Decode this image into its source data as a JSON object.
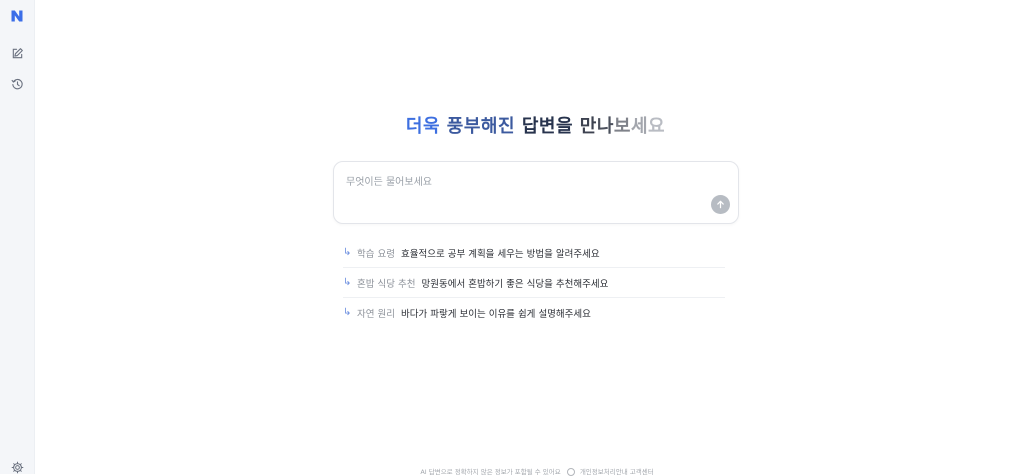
{
  "sidebar": {
    "logo": "naver-n-logo",
    "items": [
      {
        "icon": "edit-icon",
        "name": "new-chat"
      },
      {
        "icon": "history-icon",
        "name": "history"
      }
    ],
    "settings_icon": "gear-icon"
  },
  "headline": {
    "words": [
      "더욱",
      "풍부해진",
      "답변을",
      "만나보세요"
    ]
  },
  "prompt": {
    "placeholder": "무엇이든 물어보세요",
    "value": ""
  },
  "suggestions": [
    {
      "tag": "학습 요령",
      "text": "효율적으로 공부 계획을 세우는 방법을 알려주세요"
    },
    {
      "tag": "혼밥 식당 추천",
      "text": "망원동에서 혼밥하기 좋은 식당을 추천해주세요"
    },
    {
      "tag": "자연 원리",
      "text": "바다가 파랗게 보이는 이유를 쉽게 설명해주세요"
    }
  ],
  "footer": {
    "notice": "AI 답변으로 정확하지 않은 정보가 포함될 수 있어요",
    "privacy": "개인정보처리안내",
    "support": "고객센터"
  },
  "colors": {
    "accent": "#3d6fe0",
    "sidebar_bg": "#f4f6f9",
    "send_button": "#b7bcc3"
  }
}
